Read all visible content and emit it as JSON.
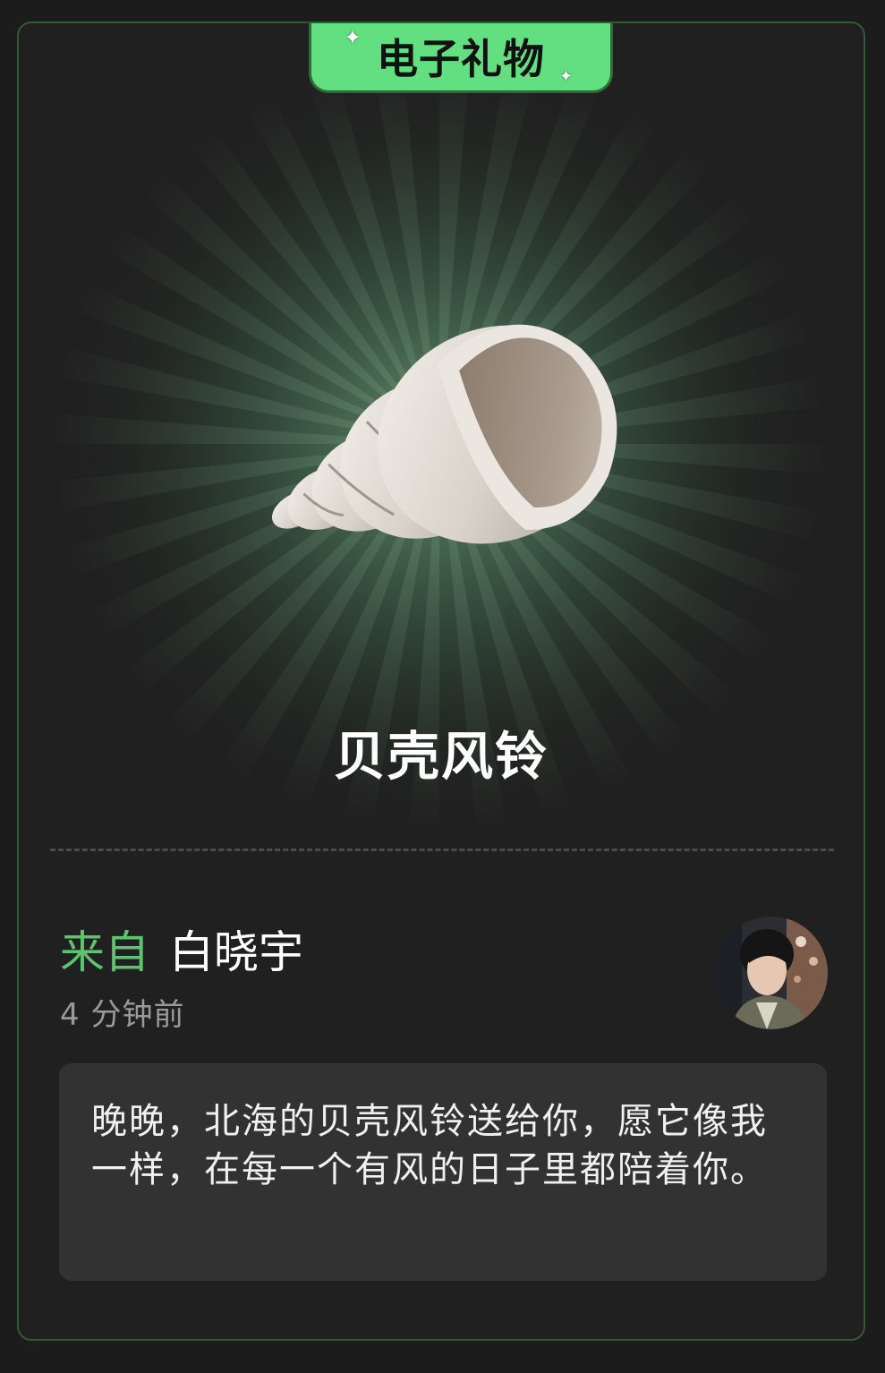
{
  "badge": {
    "label": "电子礼物"
  },
  "gift": {
    "name": "贝壳风铃",
    "icon": "seashell-icon"
  },
  "sender": {
    "from_label": "来自",
    "name": "白晓宇",
    "time": "4 分钟前",
    "avatar_icon": "avatar"
  },
  "message": {
    "text": "晚晚，北海的贝壳风铃送给你，愿它像我一样，在每一个有风的日子里都陪着你。"
  },
  "colors": {
    "accent": "#62df80",
    "from_label": "#5cc36e",
    "card_border": "#2f5a36",
    "background": "#202020",
    "message_bg": "#323232"
  }
}
